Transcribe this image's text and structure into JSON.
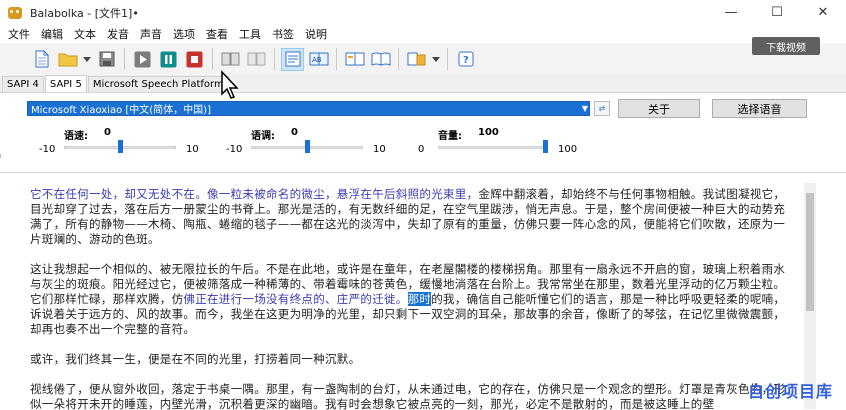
{
  "window": {
    "title": "Balabolka - [文件1]•",
    "min": "—",
    "max": "☐",
    "close": "✕"
  },
  "menu": [
    "文件",
    "编辑",
    "文本",
    "发音",
    "声音",
    "选项",
    "查看",
    "工具",
    "书签",
    "说明"
  ],
  "overlay": {
    "download_badge": "下载视频",
    "watermark": "自创项目库"
  },
  "tabs": [
    "SAPI 4",
    "SAPI 5",
    "Microsoft Speech Platform"
  ],
  "sapi": {
    "voice": "Microsoft Xiaoxiao [中文(简体，中国)]",
    "about": "关于",
    "select_voice": "选择语音",
    "rate": {
      "label": "语速:",
      "value": "0",
      "min": "-10",
      "max": "10",
      "level": 0
    },
    "pitch": {
      "label": "语调:",
      "value": "0",
      "min": "-10",
      "max": "10",
      "level": 0
    },
    "volume": {
      "label": "音量:",
      "value": "100",
      "min": "0",
      "max": "100",
      "level": 100
    }
  },
  "text": {
    "p1_hl": "它不在任何一处，却又无处不在。像一粒未被命名的微尘，悬浮在午后斜照的光束里，",
    "p1_rest": "金辉中翻滚着，却始终不与任何事物相触。我试图凝视它，目光却穿了过去，落在后方一册蒙尘的书脊上。那光是活的，有无数纤细的足，在空气里跋涉，悄无声息。于是，整个房间便被一种巨大的动势充满了，所有的静物——木椅、陶瓶、蜷缩的毯子——都在这光的淡泻中，失却了原有的重量，仿佛只要一阵心念的风，便能将它们吹散，还原为一片斑斓的、游动的色斑。",
    "p2_a": "这让我想起一个相似的、被无限拉长的午后。不是在此地，或许是在童年，在老屋閣楼的楼梯拐角。那里有一扇永远不开启的窗，玻璃上积着雨水与灰尘的斑痕。阳光经过它，便被筛落成一种稀薄的、带着霉味的苍黄色，缓慢地淌落在台阶上。我常常坐在那里，数着光里浮动的亿万颗尘粒。它们那样忙碌，那样欢腾，仿",
    "p2_hl": "佛正在进行一场没有终点的、庄严的迁徙。",
    "p2_sel": "那时",
    "p2_rest": "的我，确信自己能听懂它们的语言，那是一种比呼吸更轻柔的呢喃，诉说着关于远方的、风的故事。而今，我坐在这更为明净的光里，却只剩下一双空洞的耳朵，那故事的余音，像断了的琴弦，在记忆里微微震颤，却再也奏不出一个完整的音符。",
    "p3": "或许，我们终其一生，便是在不同的光里，打捞着同一种沉默。",
    "p4": "视线倦了，便从窗外收回，落定于书桌一隅。那里，有一盏陶制的台灯，从未通过电，它的存在，仿佛只是一个观念的塑形。灯罩是青灰色的，形似一朵将开未开的睡莲，内壁光滑，沉积着更深的幽暗。我有时会想象它被点亮的一刻，那光，必定不是散射的，而是被这睡上的壁"
  }
}
